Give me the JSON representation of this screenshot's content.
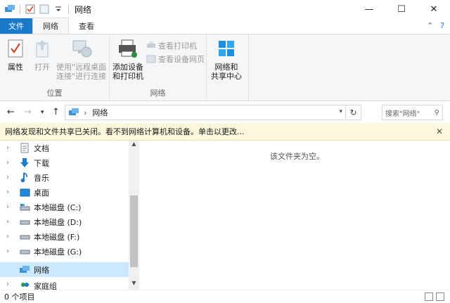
{
  "window": {
    "title": "网络"
  },
  "tabs": {
    "file": "文件",
    "network": "网络",
    "view": "查看"
  },
  "ribbon": {
    "properties": "属性",
    "open": "打开",
    "remote_desktop_line1": "使用\"远程桌面",
    "remote_desktop_line2": "连接\"进行连接",
    "add_devices_line1": "添加设备",
    "add_devices_line2": "和打印机",
    "view_printers": "查看打印机",
    "view_device_webpage": "查看设备网页",
    "network_sharing_line1": "网络和",
    "network_sharing_line2": "共享中心",
    "group_location": "位置",
    "group_network": "网络"
  },
  "address": {
    "path": "网络",
    "search_placeholder": "搜索\"网络\""
  },
  "infobar": {
    "message": "网络发现和文件共享已关闭。看不到网络计算机和设备。单击以更改..."
  },
  "navpane": {
    "items": [
      {
        "label": "文档",
        "icon": "document-icon"
      },
      {
        "label": "下载",
        "icon": "download-icon"
      },
      {
        "label": "音乐",
        "icon": "music-icon"
      },
      {
        "label": "桌面",
        "icon": "desktop-icon"
      },
      {
        "label": "本地磁盘 (C:)",
        "icon": "system-drive-icon"
      },
      {
        "label": "本地磁盘 (D:)",
        "icon": "drive-icon"
      },
      {
        "label": "本地磁盘 (F:)",
        "icon": "drive-icon"
      },
      {
        "label": "本地磁盘 (G:)",
        "icon": "drive-icon"
      },
      {
        "label": "网络",
        "icon": "network-icon"
      },
      {
        "label": "家庭组",
        "icon": "homegroup-icon"
      }
    ]
  },
  "content": {
    "empty_message": "该文件夹为空。"
  },
  "status": {
    "item_count": "0 个项目"
  },
  "colors": {
    "accent": "#1979ca",
    "selection": "#cce8ff",
    "infobar": "#fcf8dc"
  }
}
